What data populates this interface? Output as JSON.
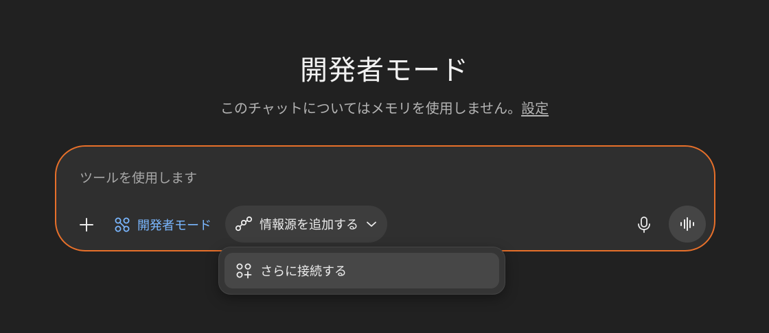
{
  "header": {
    "title": "開発者モード",
    "subtitle_text": "このチャットについてはメモリを使用しません。",
    "settings_link": "設定"
  },
  "composer": {
    "placeholder": "ツールを使用します",
    "value": "",
    "mode_chip_label": "開発者モード",
    "source_chip_label": "情報源を追加する"
  },
  "dropdown": {
    "items": [
      {
        "label": "さらに接続する",
        "icon": "connect-more-icon"
      }
    ]
  },
  "icons": {
    "plus": "plus-icon",
    "mode": "developer-mode-icon",
    "sources": "sources-icon",
    "chevron": "chevron-down-icon",
    "mic": "microphone-icon",
    "voice": "voice-mode-icon"
  },
  "colors": {
    "background": "#212121",
    "composer_border": "#e8702a",
    "accent_blue": "#7ab7ff"
  }
}
